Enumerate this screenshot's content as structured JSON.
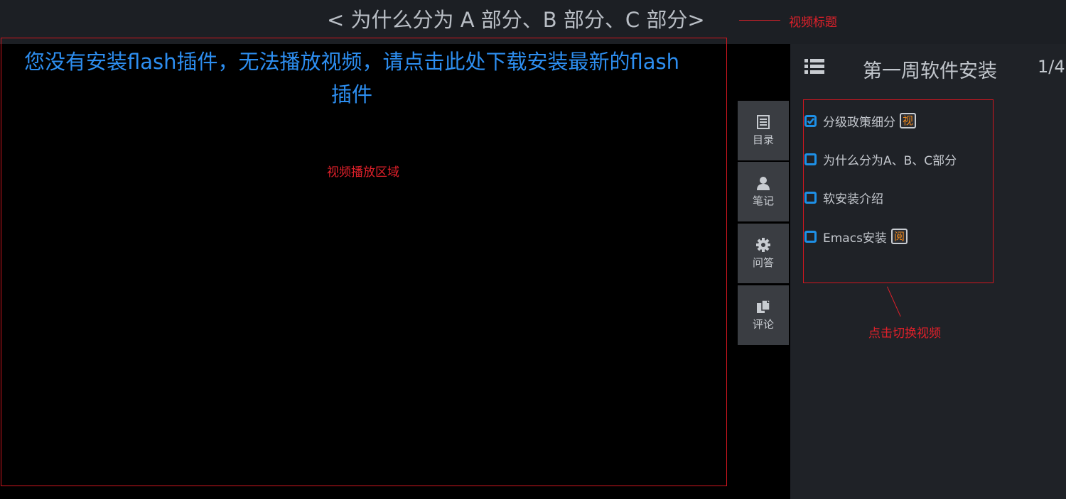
{
  "header": {
    "video_title": "< 为什么分为 A 部分、B 部分、C 部分>",
    "annotation": "视频标题"
  },
  "player": {
    "flash_message_line1": "您没有安装flash插件，无法播放视频，请点击此处下载安装最新的flash",
    "flash_message_line2": "插件",
    "annotation": "视频播放区域"
  },
  "toolbar": {
    "items": [
      {
        "label": "目录",
        "icon": "catalog-icon"
      },
      {
        "label": "笔记",
        "icon": "user-icon"
      },
      {
        "label": "问答",
        "icon": "gear-icon"
      },
      {
        "label": "评论",
        "icon": "comment-icon"
      }
    ]
  },
  "panel": {
    "title": "第一周软件安装",
    "count": "1/4",
    "items": [
      {
        "label": "分级政策细分",
        "checked": true,
        "badge": "视"
      },
      {
        "label": "为什么分为A、B、C部分",
        "checked": false,
        "badge": ""
      },
      {
        "label": "软安装介绍",
        "checked": false,
        "badge": ""
      },
      {
        "label": "Emacs安装",
        "checked": false,
        "badge": "阅"
      }
    ],
    "annotation": "点击切换视频"
  },
  "colors": {
    "accent_blue": "#1e90e6",
    "annotation_red": "#e0202a",
    "badge_orange": "#f08a1c"
  }
}
